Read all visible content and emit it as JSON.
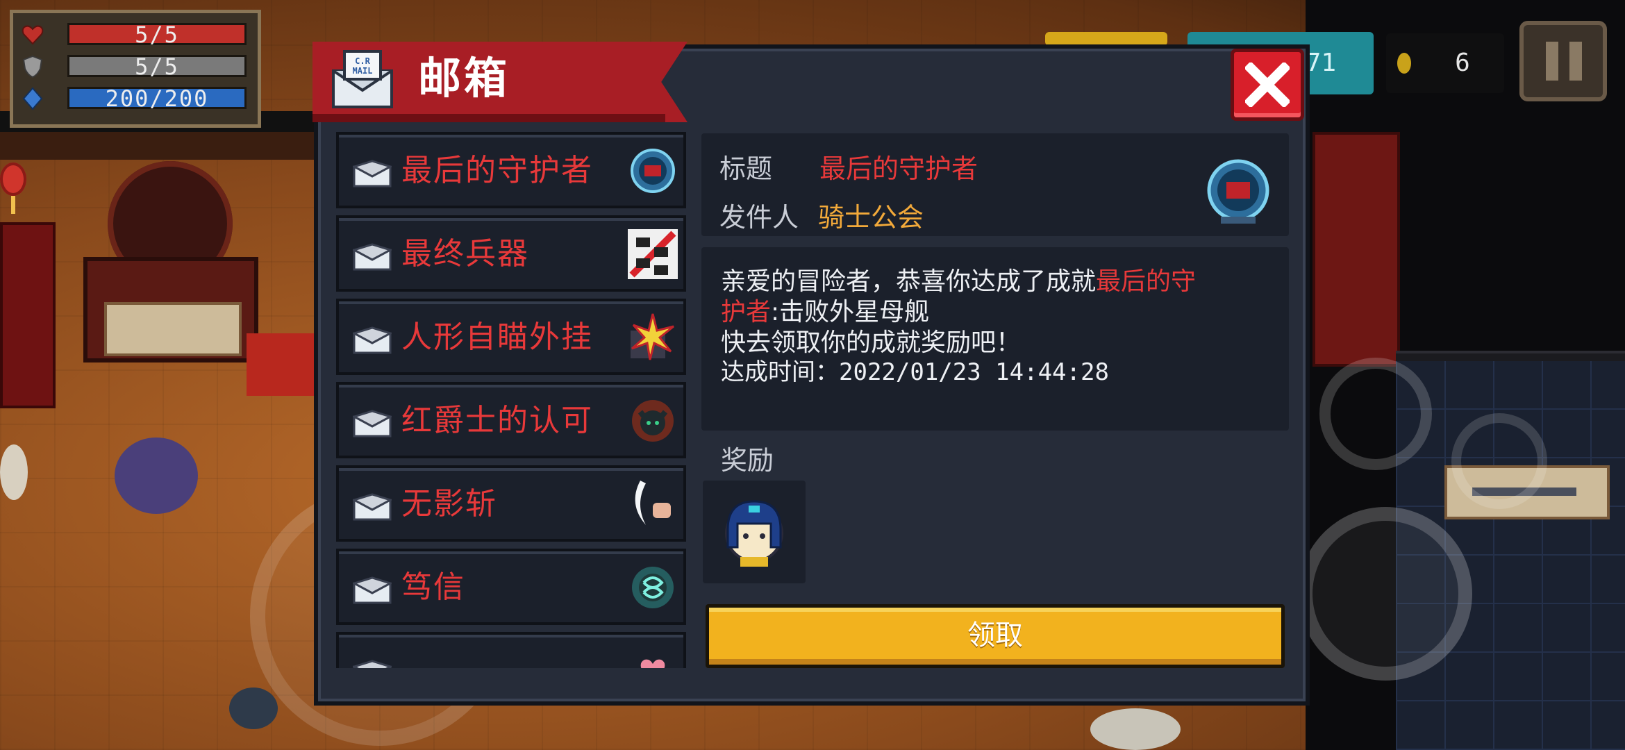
{
  "hud": {
    "hp": "5/5",
    "armor": "5/5",
    "energy": "200/200",
    "gems_partial": "71",
    "coins": "6"
  },
  "mailbox": {
    "title": "邮箱",
    "mail_icon_text": "C.R MAIL",
    "items": [
      {
        "label": "最后的守护者",
        "thumb": "guardian-orb-icon"
      },
      {
        "label": "最终兵器",
        "thumb": "ultimate-weapon-icon"
      },
      {
        "label": "人形自瞄外挂",
        "thumb": "aimbot-icon"
      },
      {
        "label": "红爵士的认可",
        "thumb": "red-knight-icon"
      },
      {
        "label": "无影斩",
        "thumb": "shadow-slash-icon"
      },
      {
        "label": "笃信",
        "thumb": "faith-icon"
      },
      {
        "label": "",
        "thumb": "heart-icon"
      }
    ],
    "detail": {
      "title_key": "标题",
      "title_value": "最后的守护者",
      "sender_key": "发件人",
      "sender_value": "骑士公会",
      "body_line1_prefix": "亲爱的冒险者，恭喜你达成了成就",
      "body_line1_highlight": "最后的守",
      "body_line2_highlight": "护者",
      "body_line2_suffix": ":击败外星母舰",
      "body_line3": "快去领取你的成就奖励吧！",
      "body_line4": "达成时间：2022/01/23 14:44:28",
      "reward_label": "奖励",
      "claim_label": "领取"
    }
  },
  "colors": {
    "banner_red": "#a81e25",
    "close_red": "#d81f2a",
    "item_text_red": "#e8393a",
    "sender_orange": "#f2a93a",
    "claim_yellow": "#f2b21e",
    "panel_bg": "#262c39"
  }
}
